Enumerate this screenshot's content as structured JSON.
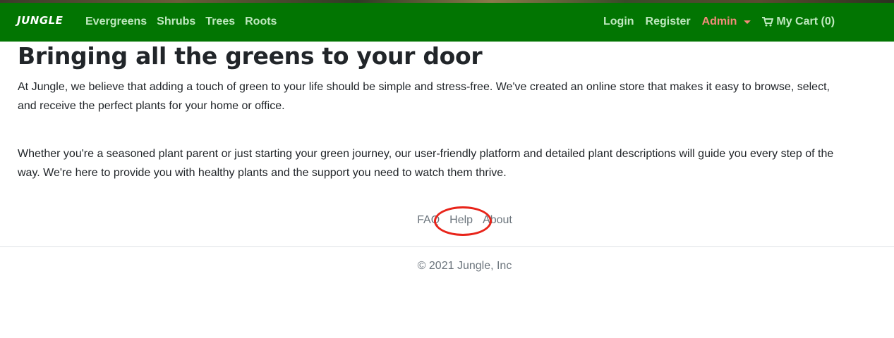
{
  "navbar": {
    "brand": "JUNGLE",
    "links": [
      "Evergreens",
      "Shrubs",
      "Trees",
      "Roots"
    ],
    "login": "Login",
    "register": "Register",
    "admin": "Admin",
    "cart": "My Cart (0)"
  },
  "main": {
    "title": "Bringing all the greens to your door",
    "paragraph1": "At Jungle, we believe that adding a touch of green to your life should be simple and stress-free. We've created an online store that makes it easy to browse, select, and receive the perfect plants for your home or office.",
    "paragraph2": "Whether you're a seasoned plant parent or just starting your green journey, our user-friendly platform and detailed plant descriptions will guide you every step of the way. We're here to provide you with healthy plants and the support you need to watch them thrive."
  },
  "footer": {
    "links": [
      "FAQ",
      "Help",
      "About"
    ],
    "copyright": "© 2021 Jungle, Inc"
  },
  "colors": {
    "navbar_bg": "#027502",
    "nav_link": "#bfe8bf",
    "admin": "#f28b7a",
    "highlight": "#e8241a"
  },
  "icons": {
    "cart": "shopping-cart-icon",
    "admin_dropdown": "caret-down-icon"
  }
}
